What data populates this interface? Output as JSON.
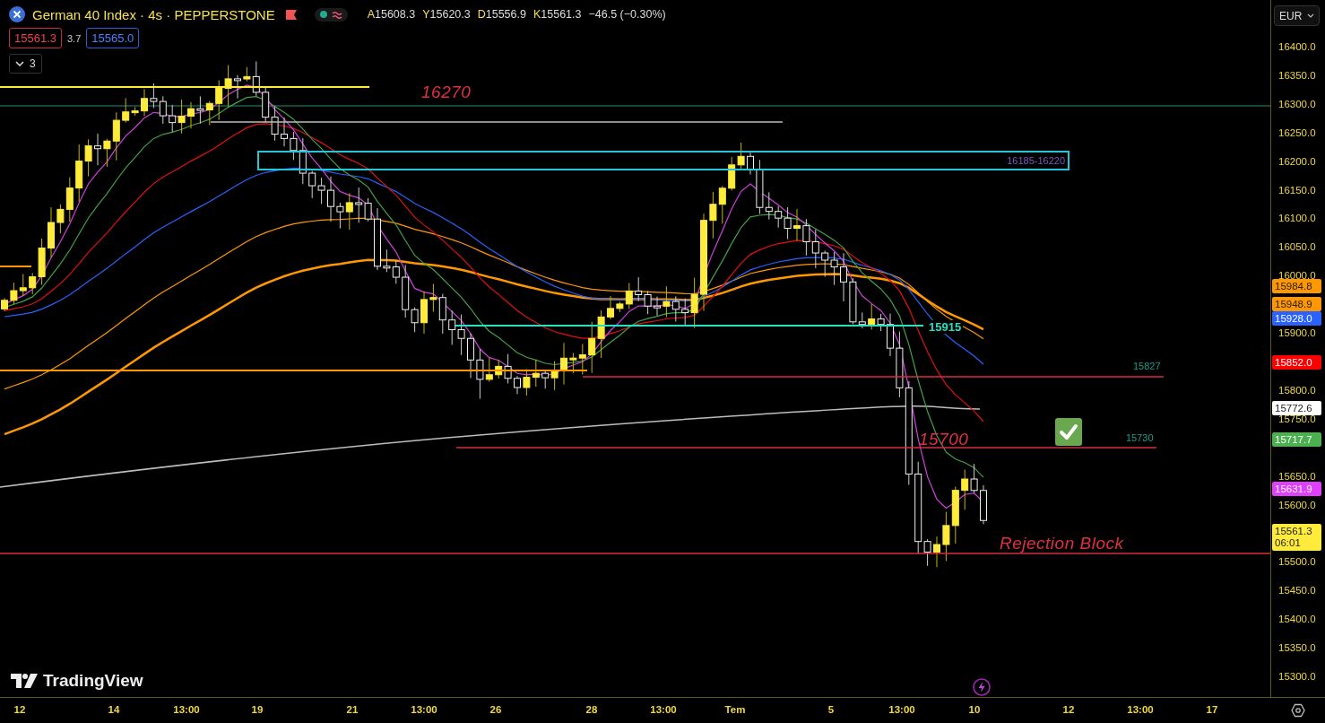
{
  "header": {
    "title": "German 40 Index · 4s · PEPPERSTONE",
    "ohlc": [
      {
        "letter": "A",
        "value": "15608.3"
      },
      {
        "letter": "Y",
        "value": "15620.3"
      },
      {
        "letter": "D",
        "value": "15556.9"
      },
      {
        "letter": "K",
        "value": "15561.3"
      }
    ],
    "change": "−46.5 (−0.30%)"
  },
  "trade": {
    "sell": "15561.3",
    "spread": "3.7",
    "buy": "15565.0"
  },
  "indicators_toggle": {
    "count": "3"
  },
  "currency": "EUR",
  "drawings": [
    {
      "kind": "text",
      "text": "16270"
    },
    {
      "kind": "zone",
      "label": "16185-16220"
    },
    {
      "kind": "level",
      "label": "15915"
    },
    {
      "kind": "note",
      "text": "15827"
    },
    {
      "kind": "text",
      "text": "15700"
    },
    {
      "kind": "check"
    },
    {
      "kind": "note",
      "text": "15730"
    },
    {
      "kind": "text",
      "text": "Rejection Block"
    }
  ],
  "price_axis": {
    "labels": [
      "16400.0",
      "16350.0",
      "16300.0",
      "16250.0",
      "16200.0",
      "16150.0",
      "16100.0",
      "16050.0",
      "16000.0",
      "15900.0",
      "15800.0",
      "15750.0",
      "15650.0",
      "15600.0",
      "15500.0",
      "15450.0",
      "15400.0",
      "15350.0",
      "15300.0"
    ]
  },
  "price_badges": [
    {
      "text": "15984.8",
      "color": "#ff9800"
    },
    {
      "text": "15948.9",
      "color": "#ff9800"
    },
    {
      "text": "15928.0",
      "color": "#2962ff"
    },
    {
      "text": "15852.0",
      "color": "#ff0000"
    },
    {
      "text": "15772.6",
      "color": "#ffffff"
    },
    {
      "text": "15717.7",
      "color": "#4caf50"
    },
    {
      "text": "15631.9",
      "color": "#e040fb"
    },
    {
      "text": "15561.3",
      "countdown": "06:01",
      "color": "#ffeb3b"
    }
  ],
  "time_axis": {
    "labels": [
      "12",
      "14",
      "13:00",
      "19",
      "21",
      "13:00",
      "26",
      "28",
      "13:00",
      "Tem",
      "5",
      "13:00",
      "10",
      "12",
      "13:00",
      "17"
    ]
  },
  "brand": "TradingView"
}
